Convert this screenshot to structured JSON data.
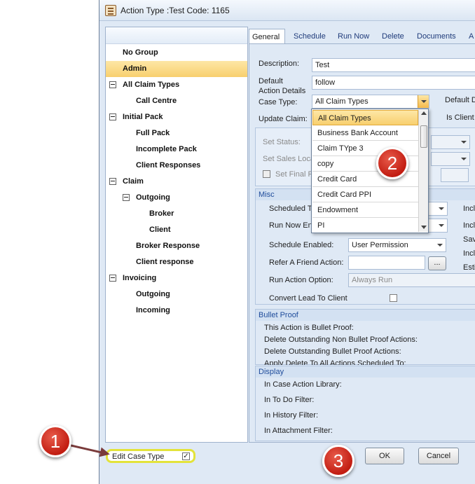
{
  "window": {
    "title": "Action Type :Test Code: 1165"
  },
  "tree": {
    "items": [
      {
        "label": "No Group"
      },
      {
        "label": "Admin"
      },
      {
        "label": "All Claim Types"
      },
      {
        "label": "Call Centre"
      },
      {
        "label": "Initial Pack"
      },
      {
        "label": "Full Pack"
      },
      {
        "label": "Incomplete Pack"
      },
      {
        "label": "Client Responses"
      },
      {
        "label": "Claim"
      },
      {
        "label": "Outgoing"
      },
      {
        "label": "Broker"
      },
      {
        "label": "Client"
      },
      {
        "label": "Broker Response"
      },
      {
        "label": "Client response"
      },
      {
        "label": "Invoicing"
      },
      {
        "label": "Outgoing"
      },
      {
        "label": "Incoming"
      }
    ],
    "edit_case_type_label": "Edit Case Type",
    "edit_case_type_checked": "✓"
  },
  "tabs": [
    "General",
    "Schedule",
    "Run Now",
    "Delete",
    "Documents",
    "A"
  ],
  "general": {
    "description_label": "Description:",
    "description_value": "Test",
    "default_action_details_label": "Default\nAction Details",
    "default_action_details_value": "follow",
    "case_type_label": "Case Type:",
    "case_type_value": "All Claim Types",
    "default_d_label": "Default D",
    "update_claim_label": "Update Claim:",
    "is_client_label": "Is Client",
    "set_status_label": "Set Status:",
    "set_sales_loca_label": "Set Sales Loca",
    "set_final_r_label": "Set Final R"
  },
  "case_type_dropdown": {
    "options": [
      "All Claim Types",
      "Business Bank Account",
      "Claim TYpe 3",
      "copy",
      "Credit Card",
      "Credit Card PPI",
      "Endowment",
      "PI"
    ],
    "selected": "All Claim Types"
  },
  "misc": {
    "title": "Misc",
    "scheduled_t_label": "Scheduled T",
    "run_now_en_label": "Run Now En",
    "schedule_enabled_label": "Schedule Enabled:",
    "schedule_enabled_value": "User Permission",
    "refer_friend_label": "Refer A Friend Action:",
    "ellipsis": "...",
    "run_action_option_label": "Run Action Option:",
    "run_action_option_value": "Always Run",
    "convert_lead_label": "Convert Lead To Client",
    "right_labels": [
      "Incl",
      "Incl",
      "Sav",
      "Incl",
      "Esti"
    ]
  },
  "bullet_proof": {
    "title": "Bullet Proof",
    "items": [
      "This Action is Bullet Proof:",
      "Delete Outstanding Non Bullet Proof Actions:",
      "Delete Outstanding Bullet Proof Actions:",
      "Apply Delete To All Actions Scheduled To:"
    ]
  },
  "display": {
    "title": "Display",
    "items": [
      "In Case Action Library:",
      "In To Do Filter:",
      "In History Filter:",
      "In Attachment Filter:"
    ]
  },
  "buttons": {
    "ok": "OK",
    "cancel": "Cancel"
  },
  "callouts": {
    "one": "1",
    "two": "2",
    "three": "3"
  },
  "colors": {
    "accent_highlight": "#f8cf6e",
    "callout_red": "#c21d12",
    "window_bg": "#dfe9f5",
    "edit_case_outline": "#e3e33a"
  }
}
